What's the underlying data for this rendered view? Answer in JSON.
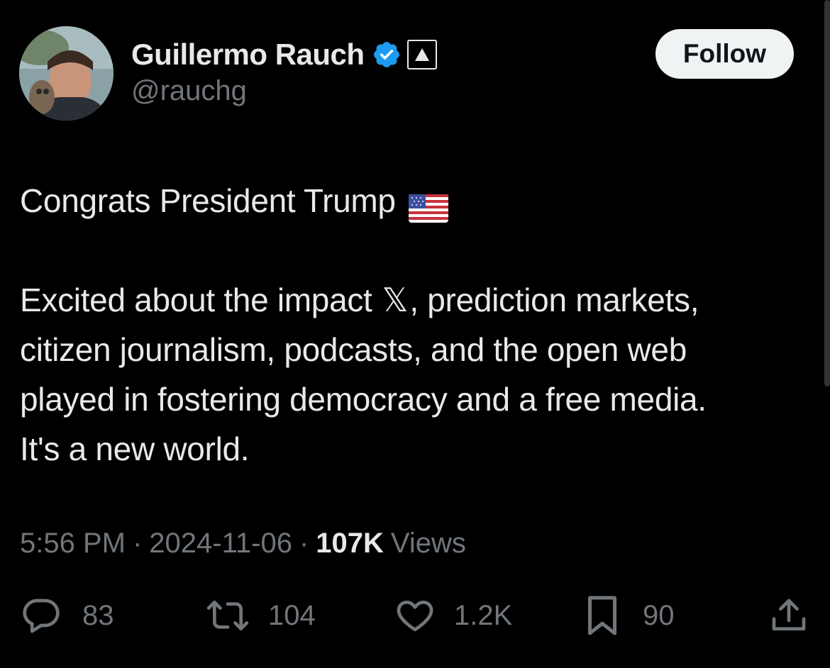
{
  "tweet": {
    "author": {
      "display_name": "Guillermo Rauch",
      "handle": "@rauchg",
      "verified_color": "#1d9bf0"
    },
    "follow_label": "Follow",
    "text": {
      "line1": "Congrats President Trump",
      "flag_icon": "us-flag-emoji",
      "line2_before_x": "Excited about the impact",
      "x_glyph": "𝕏",
      "line2_after_x": ", prediction markets,",
      "line3": "citizen journalism, podcasts, and the open web",
      "line4": "played in fostering democracy and a free media.",
      "line5": "It's a new world."
    },
    "meta": {
      "time": "5:56 PM",
      "separator": "·",
      "date": "2024-11-06",
      "views_count": "107K",
      "views_label": "Views"
    },
    "actions": {
      "replies": "83",
      "reposts": "104",
      "likes": "1.2K",
      "bookmarks": "90"
    }
  },
  "colors": {
    "background": "#000000",
    "primary_text": "#e7e9ea",
    "secondary_text": "#71767b",
    "follow_bg": "#eff3f4"
  }
}
